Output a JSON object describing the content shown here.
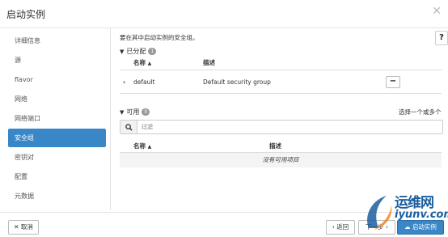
{
  "dialog": {
    "title": "启动实例"
  },
  "sidebar": {
    "items": [
      {
        "label": "详细信息"
      },
      {
        "label": "源"
      },
      {
        "label": "flavor"
      },
      {
        "label": "网络"
      },
      {
        "label": "网络端口"
      },
      {
        "label": "安全组",
        "active": true
      },
      {
        "label": "密钥对"
      },
      {
        "label": "配置"
      },
      {
        "label": "元数据"
      }
    ]
  },
  "main": {
    "description": "要在其中启动实例的安全组。",
    "allocated": {
      "label": "已分配",
      "count": "1",
      "columns": {
        "name": "名称",
        "description": "描述"
      },
      "rows": [
        {
          "name": "default",
          "description": "Default security group"
        }
      ]
    },
    "available": {
      "label": "可用",
      "count": "0",
      "hint": "选择一个或多个",
      "search_placeholder": "过滤",
      "columns": {
        "name": "名称",
        "description": "描述"
      },
      "empty_text": "没有可用项目"
    }
  },
  "footer": {
    "cancel_label": "取消",
    "back_label": "返回",
    "next_label": "下一步",
    "launch_label": "启动实例"
  },
  "watermark": {
    "line1": "运维网",
    "line2": "iyunv.com"
  },
  "colors": {
    "accent": "#3a87c8",
    "watermark": "#1b5e9e"
  }
}
